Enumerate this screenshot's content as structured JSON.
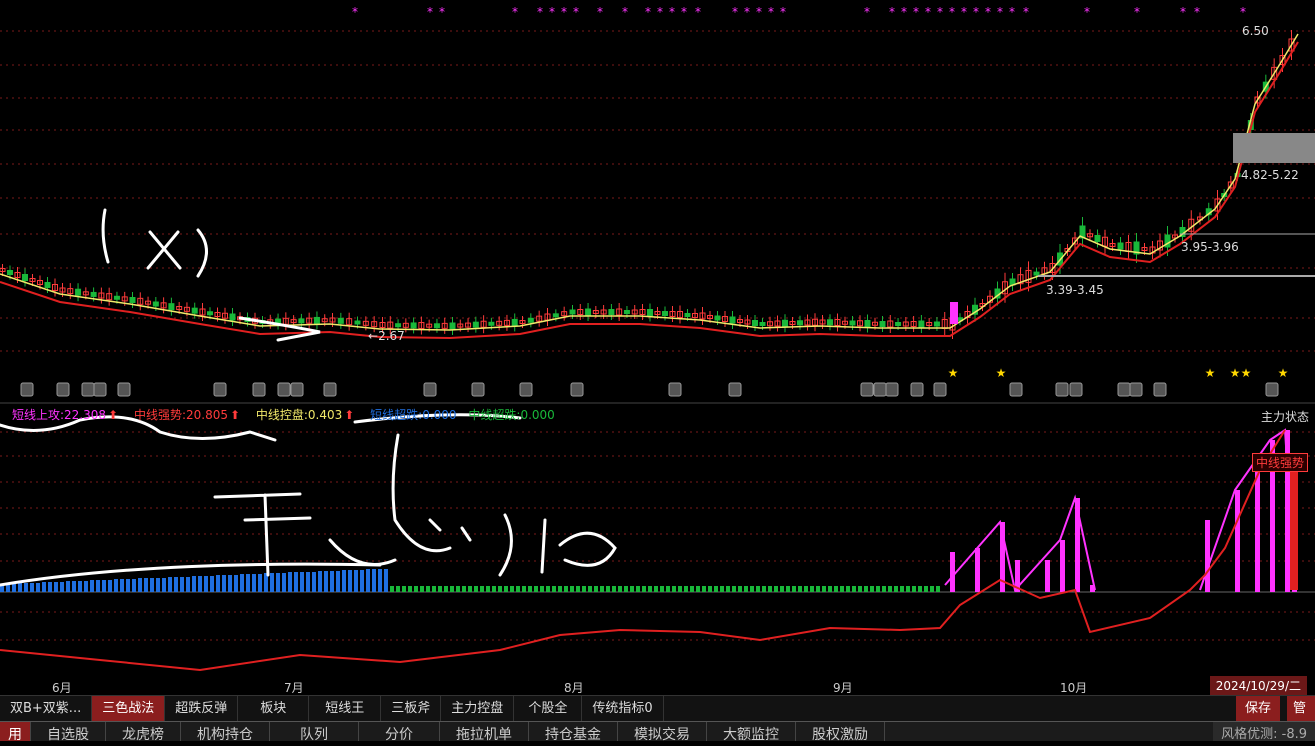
{
  "price_labels": {
    "high": "6.50",
    "zone_top": "4.82-5.22",
    "zone_mid": "3.95-3.96",
    "zone_low": "3.39-3.45",
    "low": "2.67"
  },
  "indicator_legend": {
    "short_attack": "短线上攻:22.308",
    "mid_strong": "中线强势:20.805",
    "mid_control": "中线控盘:0.403",
    "short_oversold": "短线超跌:0.000",
    "mid_oversold": "中线超跌:0.000"
  },
  "main_status_label": "主力状态",
  "status_tag": "中线强势",
  "months": [
    "6月",
    "7月",
    "8月",
    "9月",
    "10月"
  ],
  "date_label": "2024/10/29/二",
  "tabs": [
    "双B+双紫...",
    "三色战法",
    "超跌反弹",
    "板块",
    "短线王",
    "三板斧",
    "主力控盘",
    "个股全",
    "传统指标0"
  ],
  "tab_buttons": {
    "save": "保存",
    "manage": "管理"
  },
  "menu": [
    "用",
    "自选股",
    "龙虎榜",
    "机构持仓",
    "队列",
    "分价",
    "拖拉机单",
    "持仓基金",
    "模拟交易",
    "大额监控",
    "股权激励"
  ],
  "style_detect": "风格优测:",
  "style_value": "-8.9",
  "colors": {
    "up": "#ff3b3b",
    "down": "#19b83a",
    "ma_yellow": "#f2e96a",
    "ma_red": "#e02020",
    "magenta": "#ff33ff",
    "blue": "#1f6fe0",
    "active_tab": "#8b1e1e"
  }
}
